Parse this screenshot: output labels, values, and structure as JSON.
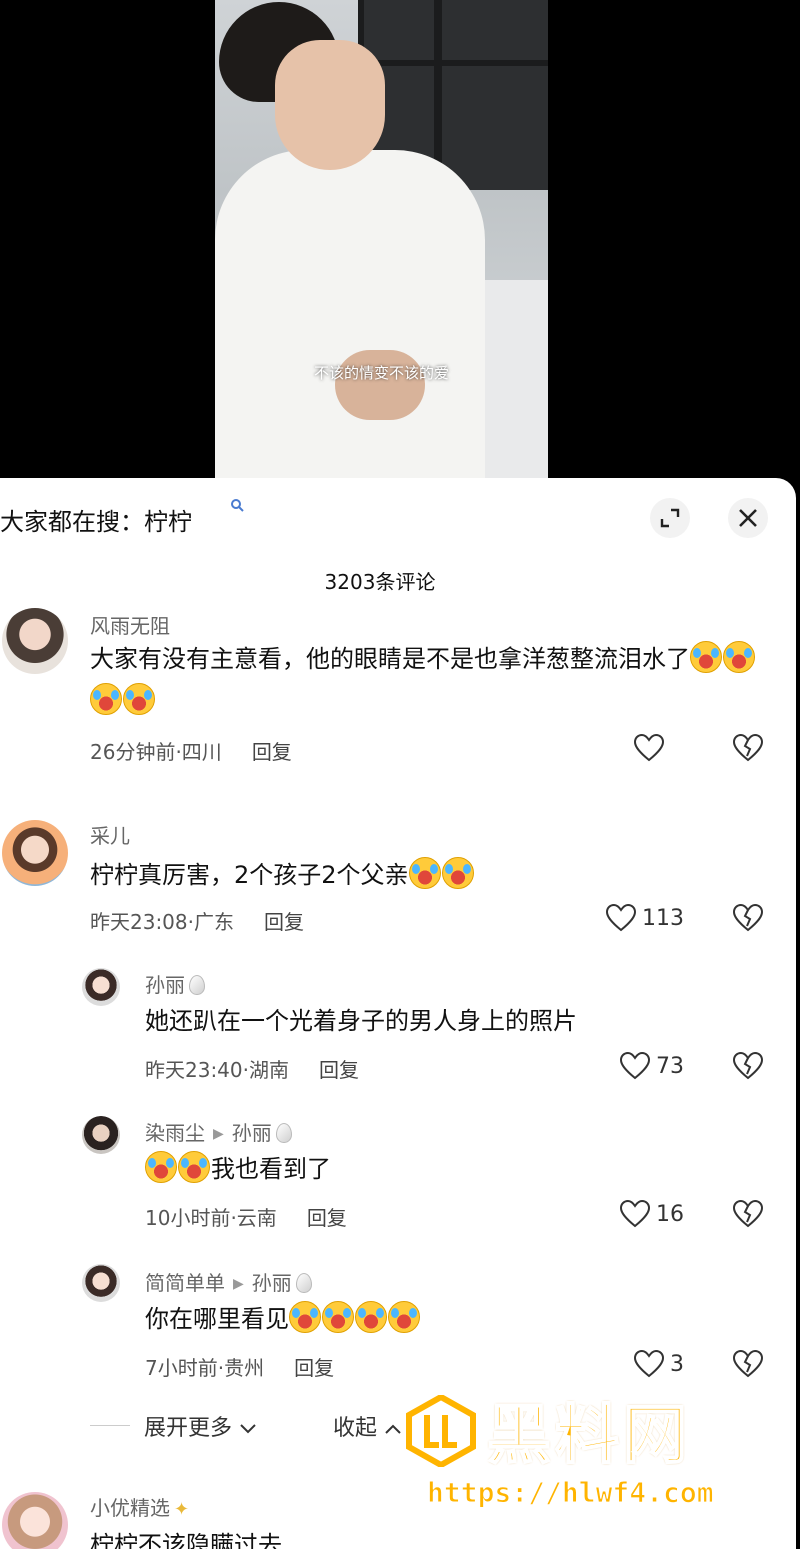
{
  "video": {
    "subtitle": "不该的情变不该的爱"
  },
  "panel": {
    "search_prefix": "大家都在搜：柠柠",
    "search_icon": "search-icon",
    "expand_icon": "fullscreen-icon",
    "close_icon": "close-icon",
    "comment_count": "3203条评论"
  },
  "comments": [
    {
      "name": "风雨无阻",
      "text": "大家有没有主意看，他的眼睛是不是也拿洋葱整流泪水了",
      "emoji_count": 4,
      "time_location": "26分钟前·四川",
      "reply": "回复",
      "likes": ""
    },
    {
      "name": "采儿",
      "text": "柠柠真厉害，2个孩子2个父亲",
      "emoji_count": 2,
      "time_location": "昨天23:08·广东",
      "reply": "回复",
      "likes": "113"
    }
  ],
  "replies": [
    {
      "name": "孙丽",
      "reply_to": "",
      "text": "她还趴在一个光着身子的男人身上的照片",
      "time_location": "昨天23:40·湖南",
      "reply": "回复",
      "likes": "73"
    },
    {
      "name": "染雨尘",
      "reply_to": "孙丽",
      "text": "我也看到了",
      "time_location": "10小时前·云南",
      "reply": "回复",
      "likes": "16"
    },
    {
      "name": "简简单单",
      "reply_to": "孙丽",
      "text": "你在哪里看见",
      "time_location": "7小时前·贵州",
      "reply": "回复",
      "likes": "3"
    }
  ],
  "expand": {
    "more": "展开更多",
    "collapse": "收起"
  },
  "last_comment": {
    "name": "小优精选",
    "text": "柠柠不该隐瞒过去"
  },
  "watermark": {
    "title": "黑料网",
    "url": "https://hlwf4.com"
  },
  "colors": {
    "accent_link": "#4a7bd0",
    "watermark": "#ffb400"
  }
}
